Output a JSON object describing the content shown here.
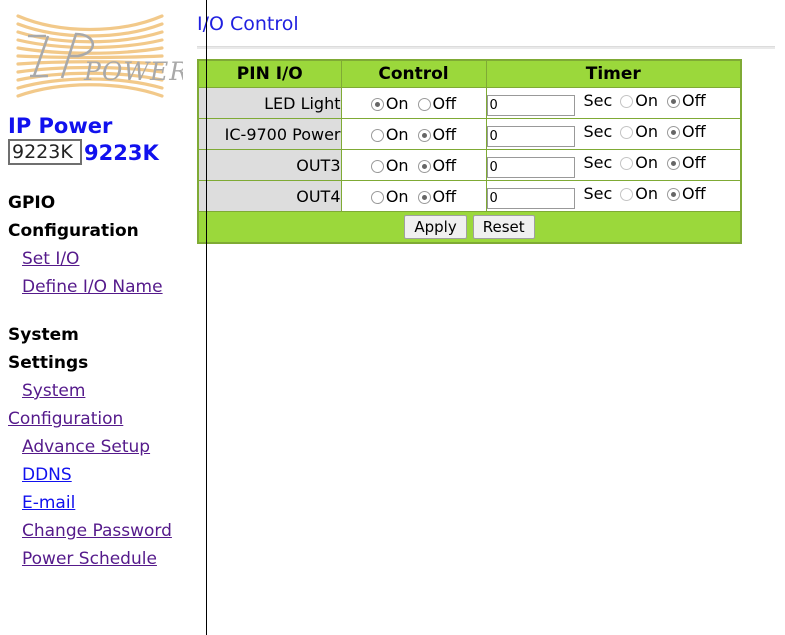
{
  "sidebar": {
    "logo_alt": "IP Power logo",
    "brand": "IP Power",
    "model_input_value": "9223K",
    "model_label": "9223K",
    "sections": [
      {
        "heading": "GPIO Configuration",
        "links": [
          "Set I/O",
          "Define I/O Name"
        ]
      },
      {
        "heading": "System Settings",
        "links": [
          "System Configuration",
          "Advance Setup",
          "DDNS",
          "E-mail",
          "Change Password",
          "Power Schedule"
        ]
      }
    ]
  },
  "main": {
    "title": "I/O Control",
    "table": {
      "headers": [
        "PIN I/O",
        "Control",
        "Timer"
      ],
      "rows": [
        {
          "pin": "LED Light",
          "control_on": "On",
          "control_off": "Off",
          "control_state": "on",
          "timer_value": "0",
          "sec_label": "Sec",
          "timer_on": "On",
          "timer_off": "Off",
          "timer_state": "off"
        },
        {
          "pin": "IC-9700 Power",
          "control_on": "On",
          "control_off": "Off",
          "control_state": "off",
          "timer_value": "0",
          "sec_label": "Sec",
          "timer_on": "On",
          "timer_off": "Off",
          "timer_state": "off"
        },
        {
          "pin": "OUT3",
          "control_on": "On",
          "control_off": "Off",
          "control_state": "off",
          "timer_value": "0",
          "sec_label": "Sec",
          "timer_on": "On",
          "timer_off": "Off",
          "timer_state": "off"
        },
        {
          "pin": "OUT4",
          "control_on": "On",
          "control_off": "Off",
          "control_state": "off",
          "timer_value": "0",
          "sec_label": "Sec",
          "timer_on": "On",
          "timer_off": "Off",
          "timer_state": "off"
        }
      ],
      "apply_label": "Apply",
      "reset_label": "Reset"
    }
  },
  "colors": {
    "header_green": "#9bd83b",
    "table_border_green": "#7faa35",
    "pin_cell_gray": "#dddddd",
    "title_blue": "#2020e0",
    "brand_blue": "#1111ee",
    "link_visited": "#551a8b",
    "link_fresh": "#1111ee"
  }
}
